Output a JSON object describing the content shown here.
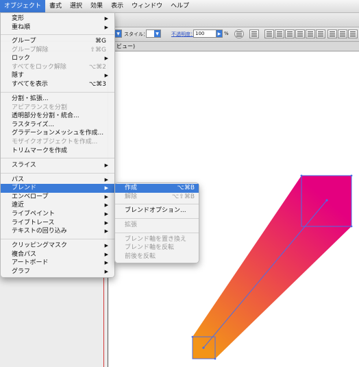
{
  "menubar": {
    "items": [
      {
        "label": "オブジェクト",
        "active": true
      },
      {
        "label": "書式"
      },
      {
        "label": "選択"
      },
      {
        "label": "効果"
      },
      {
        "label": "表示"
      },
      {
        "label": "ウィンドウ"
      },
      {
        "label": "ヘルプ"
      }
    ]
  },
  "control_bar": {
    "style_label": "スタイル：",
    "opacity_label": "不透明度：",
    "opacity_value": "100",
    "percent": "%"
  },
  "tab": {
    "label": "ビュー)"
  },
  "menu": {
    "items": [
      {
        "label": "変形",
        "submenu": true
      },
      {
        "label": "重ね順",
        "submenu": true
      },
      {
        "label": "グループ",
        "shortcut": "⌘G"
      },
      {
        "label": "グループ解除",
        "shortcut": "⇧⌘G",
        "disabled": true
      },
      {
        "label": "ロック",
        "submenu": true
      },
      {
        "label": "すべてをロック解除",
        "shortcut": "⌥⌘2",
        "disabled": true
      },
      {
        "label": "隠す",
        "submenu": true
      },
      {
        "label": "すべてを表示",
        "shortcut": "⌥⌘3"
      },
      {
        "label": "分割・拡張..."
      },
      {
        "label": "アピアランスを分割",
        "disabled": true
      },
      {
        "label": "透明部分を分割・統合..."
      },
      {
        "label": "ラスタライズ..."
      },
      {
        "label": "グラデーションメッシュを作成..."
      },
      {
        "label": "モザイクオブジェクトを作成...",
        "disabled": true
      },
      {
        "label": "トリムマークを作成"
      },
      {
        "label": "スライス",
        "submenu": true
      },
      {
        "label": "パス",
        "submenu": true
      },
      {
        "label": "ブレンド",
        "submenu": true,
        "highlighted": true
      },
      {
        "label": "エンベロープ",
        "submenu": true
      },
      {
        "label": "遠近",
        "submenu": true
      },
      {
        "label": "ライブペイント",
        "submenu": true
      },
      {
        "label": "ライブトレース",
        "submenu": true
      },
      {
        "label": "テキストの回り込み",
        "submenu": true
      },
      {
        "label": "クリッピングマスク",
        "submenu": true
      },
      {
        "label": "複合パス",
        "submenu": true
      },
      {
        "label": "アートボード",
        "submenu": true
      },
      {
        "label": "グラフ",
        "submenu": true
      }
    ]
  },
  "submenu": {
    "items": [
      {
        "label": "作成",
        "shortcut": "⌥⌘B",
        "highlighted": true
      },
      {
        "label": "解除",
        "shortcut": "⌥⇧⌘B",
        "disabled": true
      },
      {
        "label": "ブレンドオプション..."
      },
      {
        "label": "拡張",
        "disabled": true
      },
      {
        "label": "ブレンド軸を置き換え",
        "disabled": true
      },
      {
        "label": "ブレンド軸を反転",
        "disabled": true
      },
      {
        "label": "前後を反転",
        "disabled": true
      }
    ]
  },
  "colors": {
    "highlight": "#3b7bd8",
    "blend_start": "#f39418",
    "blend_end": "#e4007f",
    "selection": "#4a6ee8"
  },
  "icons": {
    "submenu_arrow": "chevron-right-icon"
  }
}
